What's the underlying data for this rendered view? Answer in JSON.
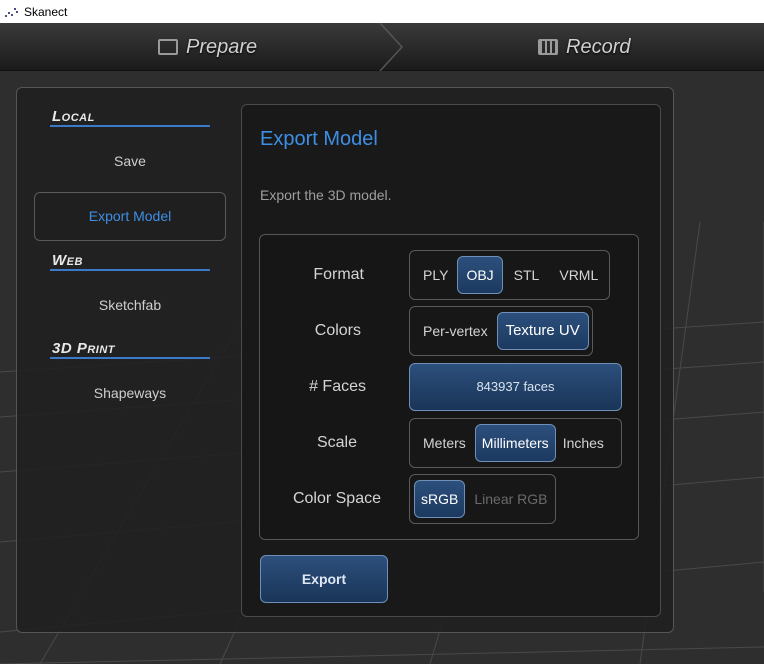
{
  "window": {
    "title": "Skanect"
  },
  "nav": {
    "prepare_label": "Prepare",
    "record_label": "Record"
  },
  "sidebar": {
    "sections": [
      {
        "heading": "Local",
        "items": [
          "Save",
          "Export Model"
        ]
      },
      {
        "heading": "Web",
        "items": [
          "Sketchfab"
        ]
      },
      {
        "heading": "3D Print",
        "items": [
          "Shapeways"
        ]
      }
    ],
    "active_item": "Export Model"
  },
  "main": {
    "title": "Export Model",
    "description": "Export the 3D model.",
    "format": {
      "label": "Format",
      "options": [
        "PLY",
        "OBJ",
        "STL",
        "VRML"
      ],
      "selected": "OBJ"
    },
    "colors": {
      "label": "Colors",
      "options": [
        "Per-vertex",
        "Texture UV"
      ],
      "selected": "Texture UV"
    },
    "faces": {
      "label": "# Faces",
      "value": "843937 faces"
    },
    "scale": {
      "label": "Scale",
      "options": [
        "Meters",
        "Millimeters",
        "Inches"
      ],
      "selected": "Millimeters"
    },
    "color_space": {
      "label": "Color Space",
      "options": [
        "sRGB",
        "Linear RGB"
      ],
      "selected": "sRGB"
    },
    "export_label": "Export"
  },
  "colors": {
    "accent": "#3d8fe6",
    "button_fill": "#1f4370"
  }
}
